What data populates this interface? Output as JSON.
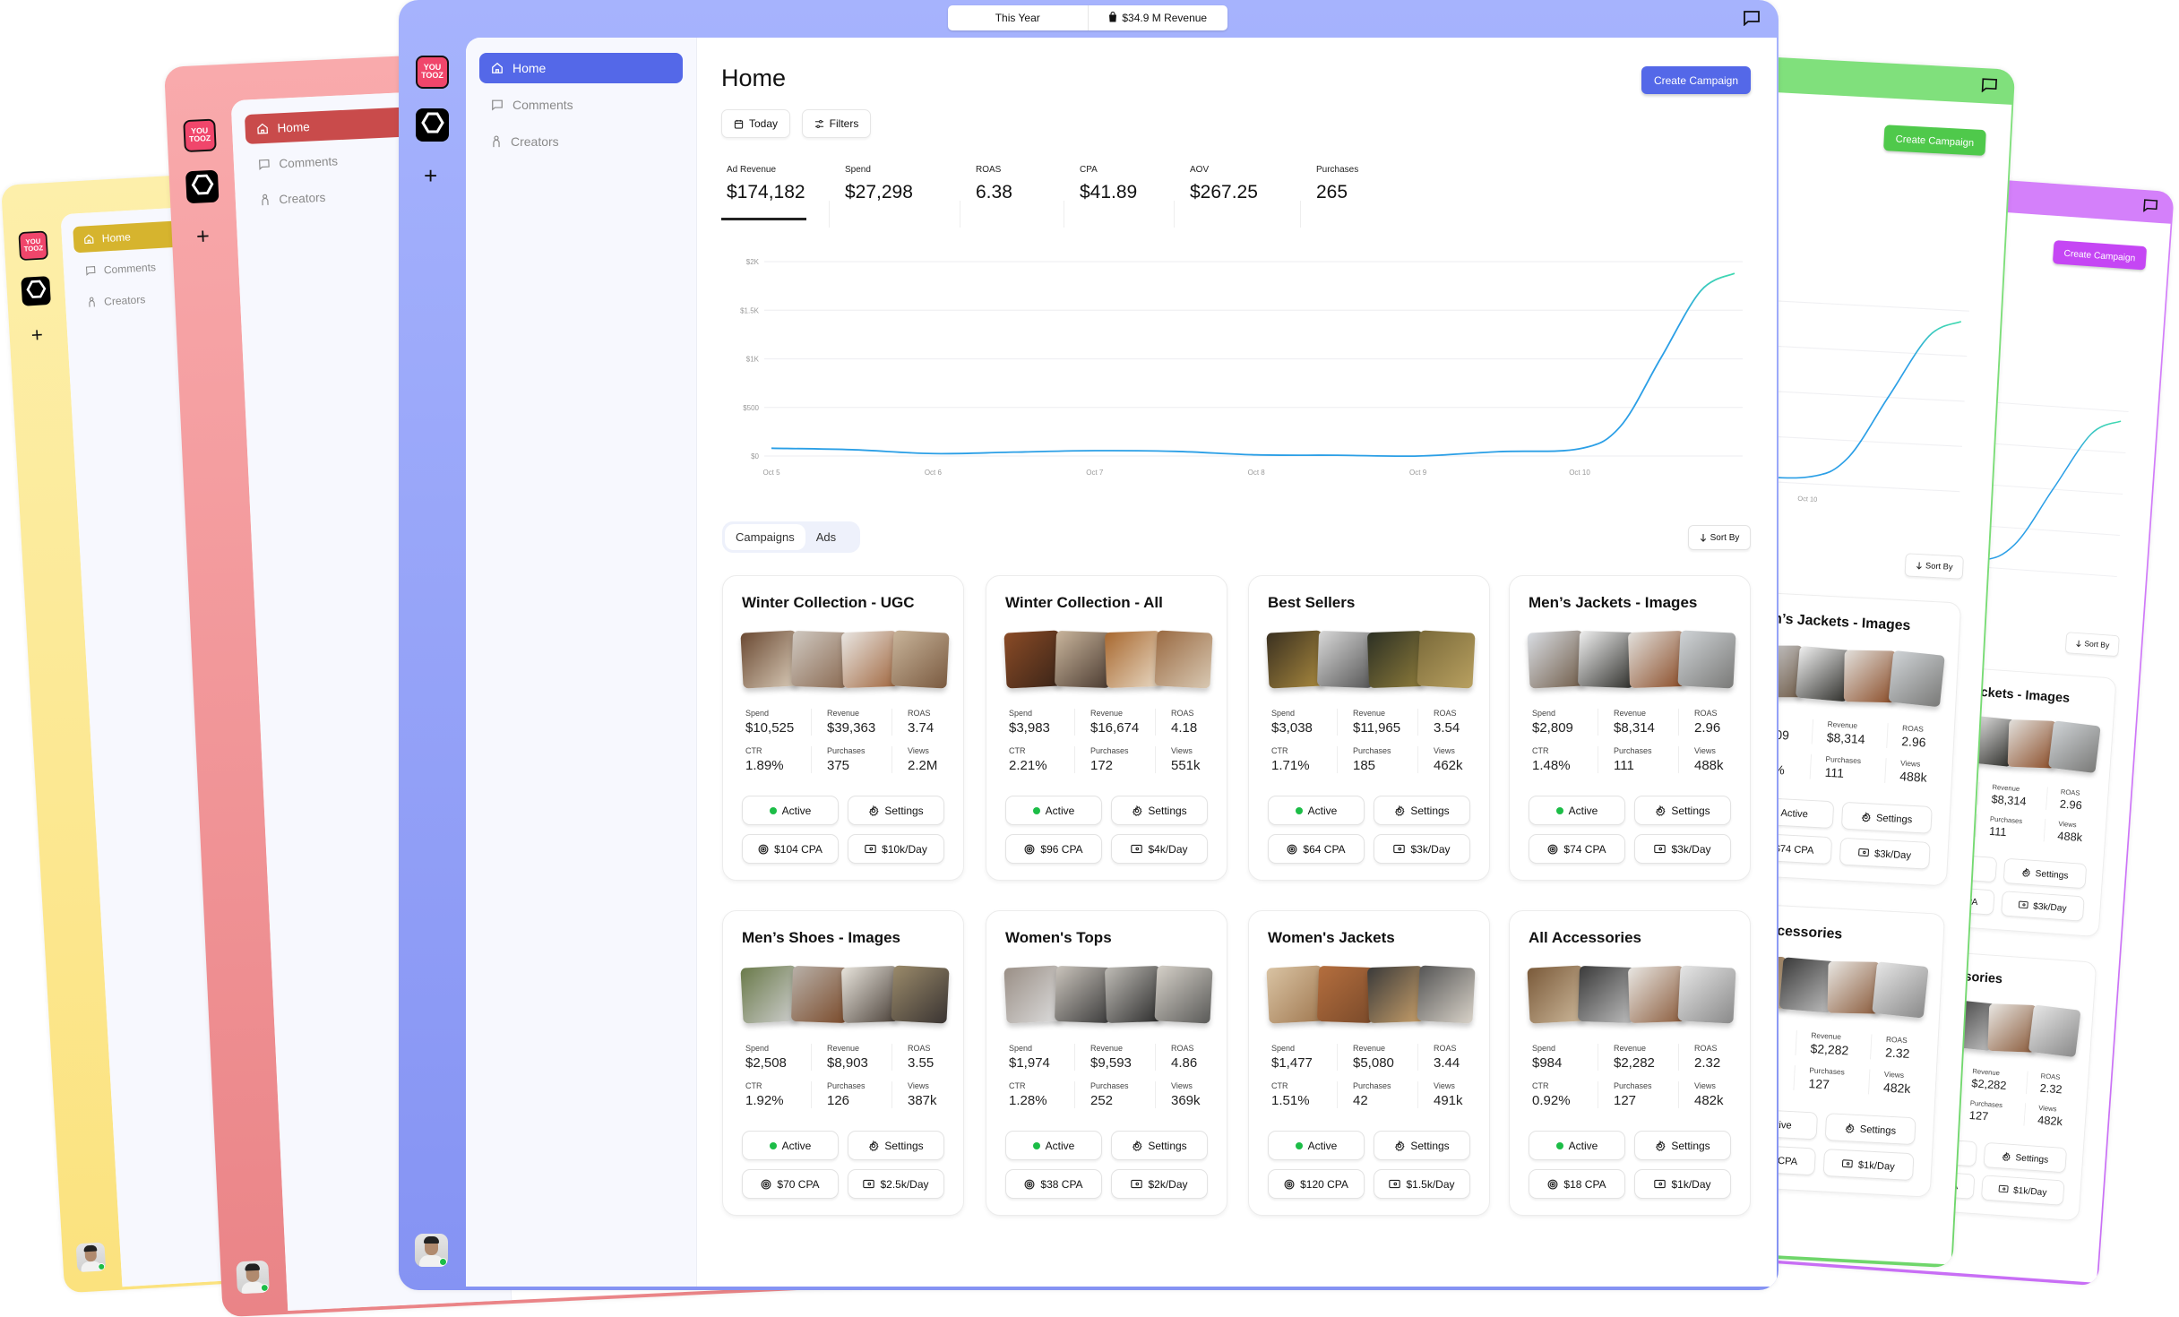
{
  "app": {
    "logos": [
      {
        "name": "youtooz-logo",
        "text": "YOU TOOZ"
      },
      {
        "name": "hexagon-brand-logo"
      }
    ],
    "add_label": "+"
  },
  "topbar": {
    "period": "This Year",
    "revenue": "$34.9 M Revenue",
    "revenue_icon": "shopping-bag-icon",
    "chat_icon": "chat-icon"
  },
  "sidebar": {
    "items": [
      {
        "label": "Home",
        "icon": "home-icon",
        "active": true
      },
      {
        "label": "Comments",
        "icon": "comment-icon",
        "active": false
      },
      {
        "label": "Creators",
        "icon": "person-icon",
        "active": false
      }
    ]
  },
  "main": {
    "title": "Home",
    "create_campaign": "Create Campaign",
    "today": "Today",
    "filters": "Filters",
    "metrics": [
      {
        "label": "Ad Revenue",
        "value": "$174,182"
      },
      {
        "label": "Spend",
        "value": "$27,298"
      },
      {
        "label": "ROAS",
        "value": "6.38"
      },
      {
        "label": "CPA",
        "value": "$41.89"
      },
      {
        "label": "AOV",
        "value": "$267.25"
      },
      {
        "label": "Purchases",
        "value": "265"
      }
    ],
    "tabs": [
      {
        "label": "Campaigns",
        "active": true
      },
      {
        "label": "Ads",
        "active": false
      }
    ],
    "sort_by": "Sort By",
    "stat_labels": {
      "spend": "Spend",
      "revenue": "Revenue",
      "roas": "ROAS",
      "ctr": "CTR",
      "purchases": "Purchases",
      "views": "Views"
    },
    "campaigns": [
      {
        "title": "Winter Collection - UGC",
        "spend": "$10,525",
        "revenue": "$39,363",
        "roas": "3.74",
        "ctr": "1.89%",
        "purchases": "375",
        "views": "2.2M",
        "status": "Active",
        "settings": "Settings",
        "cpa": "$104 CPA",
        "budget": "$10k/Day"
      },
      {
        "title": "Winter Collection - All",
        "spend": "$3,983",
        "revenue": "$16,674",
        "roas": "4.18",
        "ctr": "2.21%",
        "purchases": "172",
        "views": "551k",
        "status": "Active",
        "settings": "Settings",
        "cpa": "$96 CPA",
        "budget": "$4k/Day"
      },
      {
        "title": "Best Sellers",
        "spend": "$3,038",
        "revenue": "$11,965",
        "roas": "3.54",
        "ctr": "1.71%",
        "purchases": "185",
        "views": "462k",
        "status": "Active",
        "settings": "Settings",
        "cpa": "$64 CPA",
        "budget": "$3k/Day"
      },
      {
        "title": "Men’s Jackets - Images",
        "spend": "$2,809",
        "revenue": "$8,314",
        "roas": "2.96",
        "ctr": "1.48%",
        "purchases": "111",
        "views": "488k",
        "status": "Active",
        "settings": "Settings",
        "cpa": "$74 CPA",
        "budget": "$3k/Day"
      },
      {
        "title": "Men’s Shoes - Images",
        "spend": "$2,508",
        "revenue": "$8,903",
        "roas": "3.55",
        "ctr": "1.92%",
        "purchases": "126",
        "views": "387k",
        "status": "Active",
        "settings": "Settings",
        "cpa": "$70 CPA",
        "budget": "$2.5k/Day"
      },
      {
        "title": "Women's Tops",
        "spend": "$1,974",
        "revenue": "$9,593",
        "roas": "4.86",
        "ctr": "1.28%",
        "purchases": "252",
        "views": "369k",
        "status": "Active",
        "settings": "Settings",
        "cpa": "$38 CPA",
        "budget": "$2k/Day"
      },
      {
        "title": "Women's Jackets",
        "spend": "$1,477",
        "revenue": "$5,080",
        "roas": "3.44",
        "ctr": "1.51%",
        "purchases": "42",
        "views": "491k",
        "status": "Active",
        "settings": "Settings",
        "cpa": "$120 CPA",
        "budget": "$1.5k/Day"
      },
      {
        "title": "All Accessories",
        "spend": "$984",
        "revenue": "$2,282",
        "roas": "2.32",
        "ctr": "0.92%",
        "purchases": "127",
        "views": "482k",
        "status": "Active",
        "settings": "Settings",
        "cpa": "$18 CPA",
        "budget": "$1k/Day"
      }
    ]
  },
  "themes": {
    "main": "#5468e8",
    "yellow": "#d6b42e",
    "pink": "#c94b4b",
    "green": "#4fc94b",
    "purple": "#c546f4",
    "status_active": "#1cbd47",
    "line_start": "#2b9fe6",
    "line_end": "#3fd9b0"
  },
  "chart_data": {
    "type": "line",
    "title": "",
    "xlabel": "",
    "ylabel": "",
    "x_ticks": [
      "Oct 5",
      "Oct 6",
      "Oct 7",
      "Oct 8",
      "Oct 9",
      "Oct 10"
    ],
    "y_ticks": [
      "$0",
      "$500",
      "$1K",
      "$1.5K",
      "$2K"
    ],
    "y_tick_values": [
      0,
      500,
      1000,
      1500,
      2000
    ],
    "ylim": [
      0,
      2000
    ],
    "grid": true,
    "series": [
      {
        "points": [
          {
            "x": "Oct 5 00:00",
            "y": 80
          },
          {
            "x": "Oct 5 12:00",
            "y": 65
          },
          {
            "x": "Oct 6 00:00",
            "y": 25
          },
          {
            "x": "Oct 6 12:00",
            "y": 40
          },
          {
            "x": "Oct 7 00:00",
            "y": 55
          },
          {
            "x": "Oct 7 12:00",
            "y": 48
          },
          {
            "x": "Oct 8 00:00",
            "y": 12
          },
          {
            "x": "Oct 8 12:00",
            "y": 8
          },
          {
            "x": "Oct 9 00:00",
            "y": 0
          },
          {
            "x": "Oct 9 12:00",
            "y": 45
          },
          {
            "x": "Oct 10 00:00",
            "y": 75
          },
          {
            "x": "Oct 10 06:00",
            "y": 300
          },
          {
            "x": "Oct 10 12:00",
            "y": 1000
          },
          {
            "x": "Oct 10 18:00",
            "y": 1700
          },
          {
            "x": "Oct 10 23:00",
            "y": 1880
          }
        ]
      }
    ]
  }
}
